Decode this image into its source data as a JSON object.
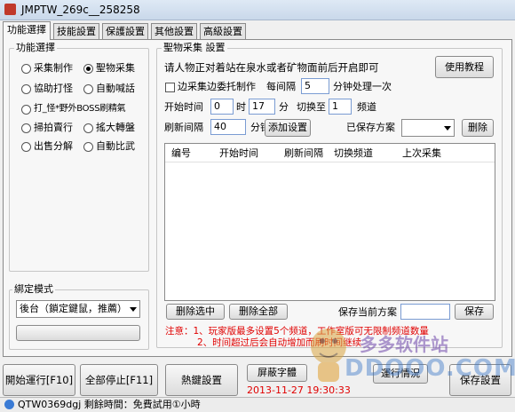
{
  "window": {
    "title": "JMPTW_269c__258258"
  },
  "tabs": [
    "功能選擇",
    "技能設置",
    "保護設置",
    "其他設置",
    "高級設置"
  ],
  "func_group": {
    "title": "功能選擇",
    "options": [
      "采集制作",
      "聖物采集",
      "協助打怪",
      "自動喊話",
      "打_怪*野外BOSS刷精氣",
      "掃拍賣行",
      "搖大轉盤",
      "出售分解",
      "自動比武"
    ],
    "selected": "聖物采集"
  },
  "bind_group": {
    "title": "綁定模式",
    "mode": "後台（鎖定鍵鼠，推薦）"
  },
  "relic": {
    "title": "聖物采集 設置",
    "hint": "请人物正对着站在泉水或者矿物面前后开启即可",
    "tutorial_btn": "使用教程",
    "side_commission_label": "边采集边委托制作",
    "every_interval_label": "每间隔",
    "every_interval_value": "5",
    "minutes_process_label": "分钟处理一次",
    "start_time_label": "开始时间",
    "start_hour": "0",
    "hour_label": "时",
    "start_min": "17",
    "min_label": "分",
    "switch_to_label": "切换至",
    "switch_to_value": "1",
    "channel_label": "频道",
    "refresh_label": "刷新间隔",
    "refresh_value": "40",
    "refresh_unit": "分钟",
    "add_setting_btn": "添加设置",
    "saved_scheme_label": "已保存方案",
    "delete_btn": "删除",
    "table_headers": [
      "编号",
      "开始时间",
      "刷新间隔",
      "切换频道",
      "上次采集"
    ],
    "delete_selected_btn": "删除选中",
    "delete_all_btn": "删除全部",
    "save_current_label": "保存当前方案",
    "save_btn": "保存",
    "note_1": "注意：1、玩家版最多设置5个频道，工作室版可无限制频道数量",
    "note_2": "2、时间超过后会自动增加而刷时间继续"
  },
  "bottom": {
    "start_btn": "開始運行[F10]",
    "stop_btn": "全部停止[F11]",
    "hotkey_btn": "熱鍵設置",
    "mask_btn": "屏蔽字體",
    "timestamp": "2013-11-27 19:30:33",
    "run_status_btn": "運行情況",
    "save_settings_btn": "保存設置"
  },
  "status": {
    "text": "QTW0369dgj 剩餘時間：免費試用①小時"
  },
  "watermark": {
    "text": "多多软件站",
    "url": "DDOOO.COM"
  },
  "colors": {
    "note": "#e00000",
    "timestamp": "#e00000",
    "accent_border": "#7a9cd3"
  }
}
